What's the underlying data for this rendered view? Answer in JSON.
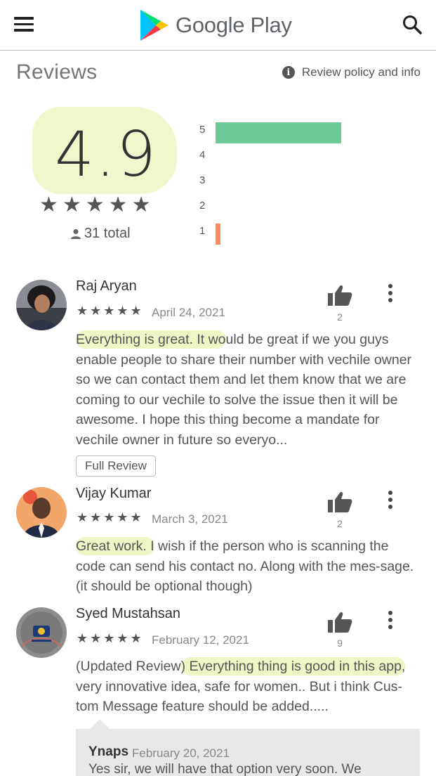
{
  "header": {
    "brand": "Google Play",
    "menu_icon": "hamburger-menu-icon",
    "search_icon": "search-icon"
  },
  "reviews_section": {
    "title": "Reviews",
    "policy_link": "Review policy and info"
  },
  "rating": {
    "score": "4.9",
    "stars": "★★★★★",
    "total": "31 total",
    "histogram": [
      {
        "label": "5",
        "fraction": 0.96,
        "color": "#6ccb98"
      },
      {
        "label": "4",
        "fraction": 0,
        "color": "#b3de8a"
      },
      {
        "label": "3",
        "fraction": 0,
        "color": "#ffd93b"
      },
      {
        "label": "2",
        "fraction": 0,
        "color": "#ffb25c"
      },
      {
        "label": "1",
        "fraction": 0.04,
        "color": "#ff8c5a"
      }
    ]
  },
  "reviews": [
    {
      "name": "Raj Aryan",
      "stars": "★★★★★",
      "date": "April 24, 2021",
      "likes": "2",
      "text_highlight": "Everything is great. It wo",
      "text_rest": "uld be great if we you guys enable people to share their number with vechile owner so we can contact them and let them know that we are coming to our vechile to solve the issue then it will be awesome. I hope this thing become a mandate for vechile owner in future so everyo...",
      "full_review_label": "Full Review"
    },
    {
      "name": "Vijay Kumar",
      "stars": "★★★★★",
      "date": "March 3, 2021",
      "likes": "2",
      "text_highlight": "Great work. I",
      "text_rest": " wish if the person who is scanning the code can send his contact no. Along with the mes-sage.(it should be optional though)"
    },
    {
      "name": "Syed Mustahsan",
      "stars": "★★★★★",
      "date": "February 12, 2021",
      "likes": "9",
      "text_before": "(Updated Review",
      "text_highlight": ") Everything thing is good in this app,",
      "text_rest": " very innovative idea, safe for women.. But i think Cus-tom Message feature should be added....."
    }
  ],
  "developer_reply": {
    "name": "Ynaps",
    "date": "February 20, 2021",
    "text": "Yes sir, we will have that option very soon. We"
  }
}
